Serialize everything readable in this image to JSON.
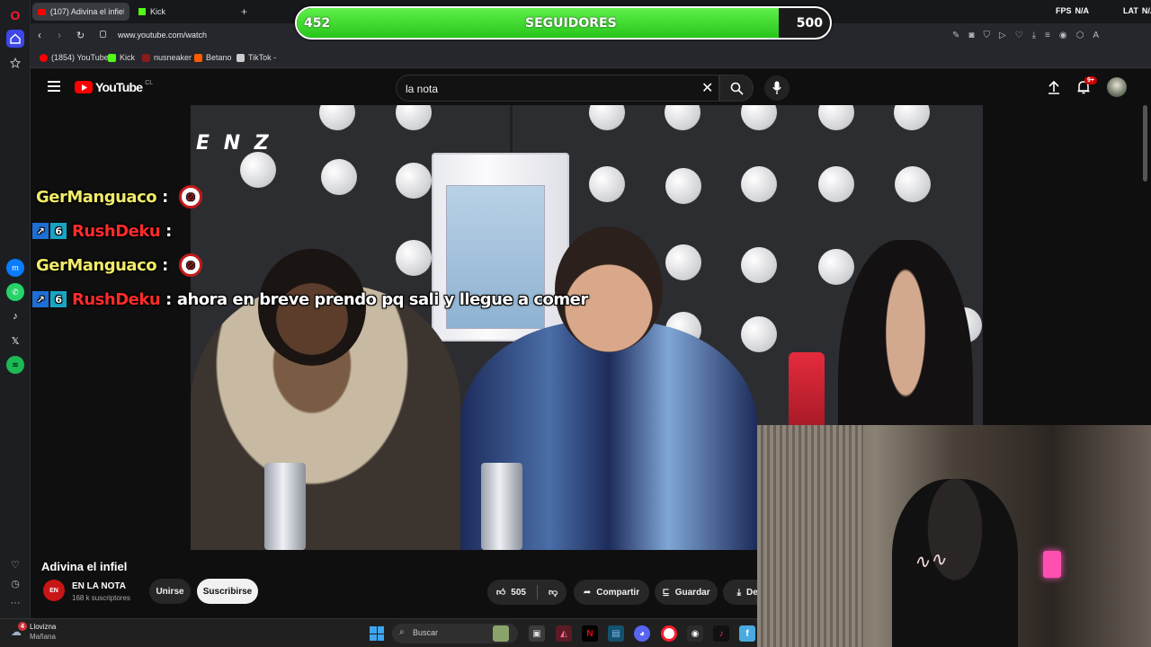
{
  "browser": {
    "tabs": [
      {
        "label": "(107) Adivina el infiel"
      },
      {
        "label": "Kick"
      }
    ],
    "new_tab_symbol": "+",
    "url": "www.youtube.com/watch",
    "bookmarks": [
      {
        "label": "(1854) YouTube",
        "color": "#ff0000"
      },
      {
        "label": "Kick",
        "color": "#53fc18"
      },
      {
        "label": "nusneaker",
        "color": "#8a1c1c"
      },
      {
        "label": "Betano",
        "color": "#ff5a00"
      },
      {
        "label": "TikTok -",
        "color": "#cccccc"
      }
    ],
    "top_right": {
      "fps_label": "FPS",
      "fps_value": "N/A",
      "lat_label": "LAT",
      "lat_value": "N/A"
    }
  },
  "overlay": {
    "current": "452",
    "label": "SEGUIDORES",
    "goal": "500",
    "progress": 0.904
  },
  "youtube": {
    "logo_text": "YouTube",
    "region": "CL",
    "search_value": "la nota",
    "notification_count": "9+"
  },
  "chat": [
    {
      "user": "GerManguaco",
      "user_color": "#f0eb6a",
      "message": ""
    },
    {
      "user": "RushDeku",
      "user_color": "#ff2b2b",
      "message": ""
    },
    {
      "user": "GerManguaco",
      "user_color": "#f0eb6a",
      "message": ""
    },
    {
      "user": "RushDeku",
      "user_color": "#ff2b2b",
      "message": "ahora en breve prendo pq sali y llegue a comer"
    }
  ],
  "video": {
    "watermark": "E N Z",
    "title": "Adivina el infiel",
    "channel": "EN LA NOTA",
    "subscribers": "168 k suscriptores",
    "join_label": "Unirse",
    "subscribe_label": "Suscribirse",
    "likes": "505",
    "share_label": "Compartir",
    "save_label": "Guardar",
    "download_label": "Des"
  },
  "taskbar": {
    "weather_badge": "4",
    "weather_title": "Llovizna",
    "weather_sub": "Mañana",
    "search_placeholder": "Buscar"
  }
}
